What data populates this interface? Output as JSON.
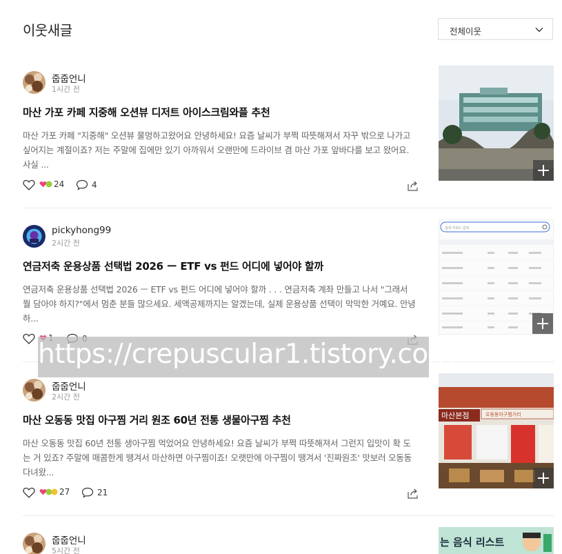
{
  "header": {
    "title": "이웃새글",
    "filter_label": "전체이웃"
  },
  "posts": [
    {
      "author": "줍줍언니",
      "time": "1시간 전",
      "title": "마산 가포 카페 지중해 오션뷰 디저트 아이스크림와플 추천",
      "excerpt": "마산 가포 카페 \"지중해\" 오션뷰 물멍하고왔어요 안녕하세요! 요즘 날씨가 부쩍 따뜻해져서 자꾸 밖으로 나가고 싶어지는 계절이죠? 저는 주말에 집에만 있기 아까워서 오랜만에 드라이브 겸 마산 가포 앞바다를 보고 왔어요. 사실 ...",
      "reactions": "24",
      "comments": "4"
    },
    {
      "author": "pickyhong99",
      "time": "2시간 전",
      "title": "연금저축 운용상품 선택법 2026 ー ETF vs 펀드 어디에 넣어야 할까",
      "excerpt": "연금저축 운용상품 선택법 2026 ㅡ ETF vs 펀드 어디에 넣어야 할까 . . . 연금저축 계좌 만들고 나서 \"그래서 뭘 담아야 하지?\"에서 멈춘 분들 많으세요. 세액공제까지는 알겠는데, 실제 운용상품 선택이 막막한 거예요. 안녕하...",
      "reactions": "1",
      "comments": "0"
    },
    {
      "author": "줍줍언니",
      "time": "2시간 전",
      "title": "마산 오동동 맛집 아구찜 거리 원조 60년 전통 생물아구찜 추천",
      "excerpt": "마산 오동동 맛집 60년 전통 생아구찜 먹었어요 안녕하세요! 요즘 날씨가 부쩍 따뜻해져서 그런지 입맛이 확 도는 거 있죠? 주말에 매콤한게 땡겨서 마산하면 아구찜이죠! 오랫만에 아구찜이 땡겨서 '진짜원조' 맛보러 오동동다녀왔...",
      "reactions": "27",
      "comments": "21"
    },
    {
      "author": "줍줍언니",
      "time": "5시간 전",
      "thumb_text": "는 음식 리스트"
    }
  ],
  "thumb2": {
    "search": "검색 키워드 입력"
  },
  "thumb3": {
    "sign": "마산본점",
    "banner": "오동동아구찜거리"
  },
  "watermark": "https://crepuscular1.tistory.com",
  "colors": {
    "text": "#222222",
    "muted": "#999999",
    "excerpt": "#666666",
    "heart": "#e8457a",
    "leaf": "#9ccc3b"
  }
}
